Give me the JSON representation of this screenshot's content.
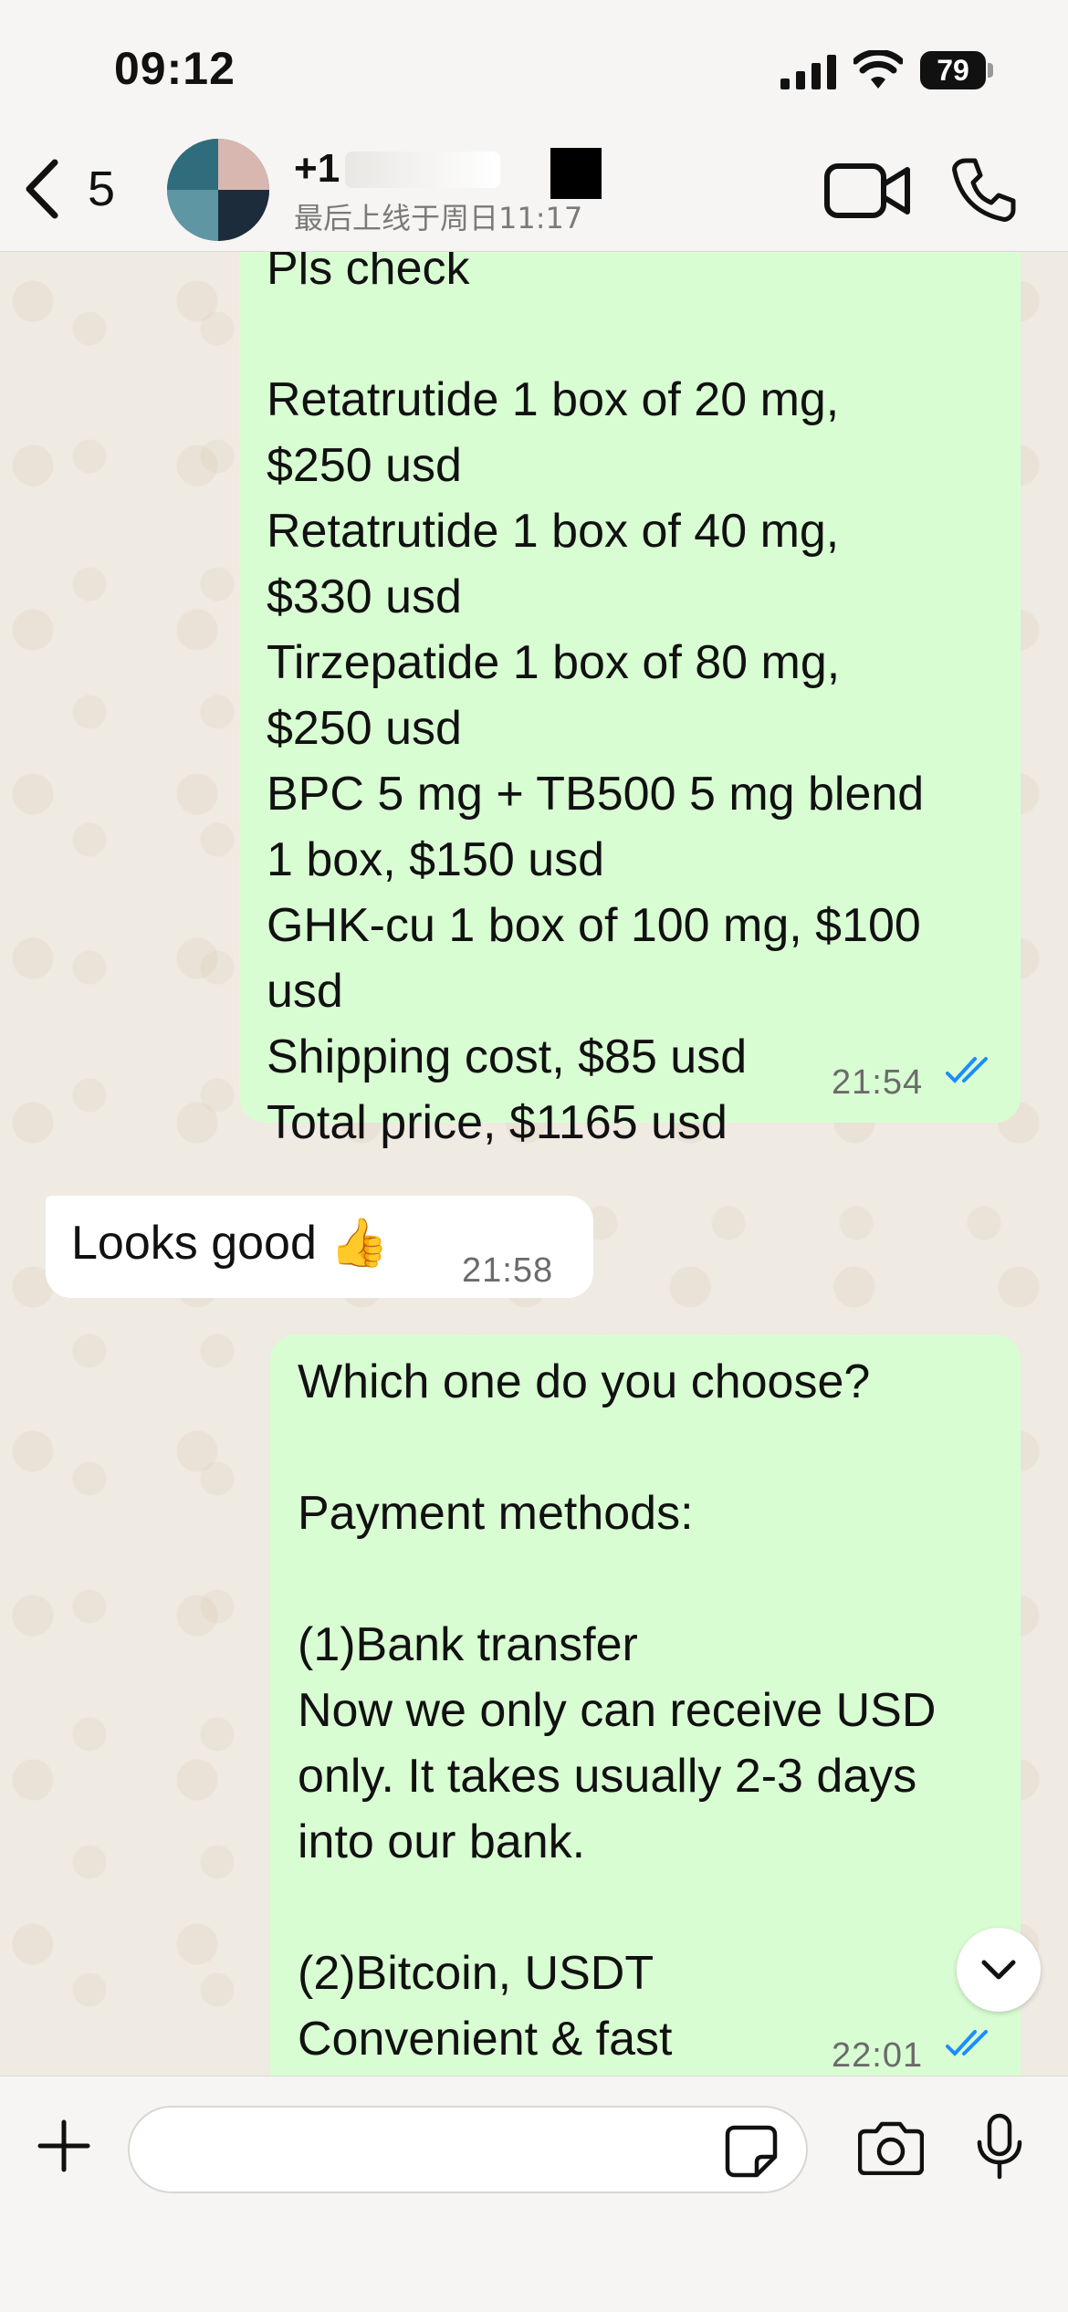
{
  "status_bar": {
    "time": "09:12",
    "battery": "79"
  },
  "header": {
    "back_count": "5",
    "contact_name": "+1",
    "last_seen": "最后上线于周日11:17"
  },
  "messages": [
    {
      "direction": "outgoing",
      "lines": [
        "Pls check",
        "",
        "Retatrutide 1 box of 20 mg,",
        "$250 usd",
        "Retatrutide  1 box of 40 mg,",
        "$330 usd",
        "Tirzepatide  1 box of 80 mg,",
        "$250 usd",
        "BPC 5 mg + TB500 5 mg blend",
        "1 box, $150 usd",
        "GHK-cu 1 box of 100 mg, $100",
        "usd",
        "Shipping cost, $85 usd",
        "Total price, $1165 usd"
      ],
      "time": "21:54",
      "status": "read"
    },
    {
      "direction": "incoming",
      "text": "Looks good",
      "emoji": "👍",
      "time": "21:58"
    },
    {
      "direction": "outgoing",
      "lines": [
        "Which one do you choose?",
        "",
        "Payment methods:",
        "",
        "(1)Bank transfer",
        "Now we only can receive USD",
        "only. It takes usually 2-3 days",
        "into our bank.",
        "",
        "(2)Bitcoin, USDT",
        "Convenient & fast"
      ],
      "time": "22:01",
      "status": "read"
    }
  ],
  "input": {
    "placeholder": ""
  },
  "colors": {
    "outgoing_bubble": "#d9fdd3",
    "incoming_bubble": "#ffffff",
    "read_ticks": "#1b8dff",
    "chat_background": "#efeae2"
  }
}
